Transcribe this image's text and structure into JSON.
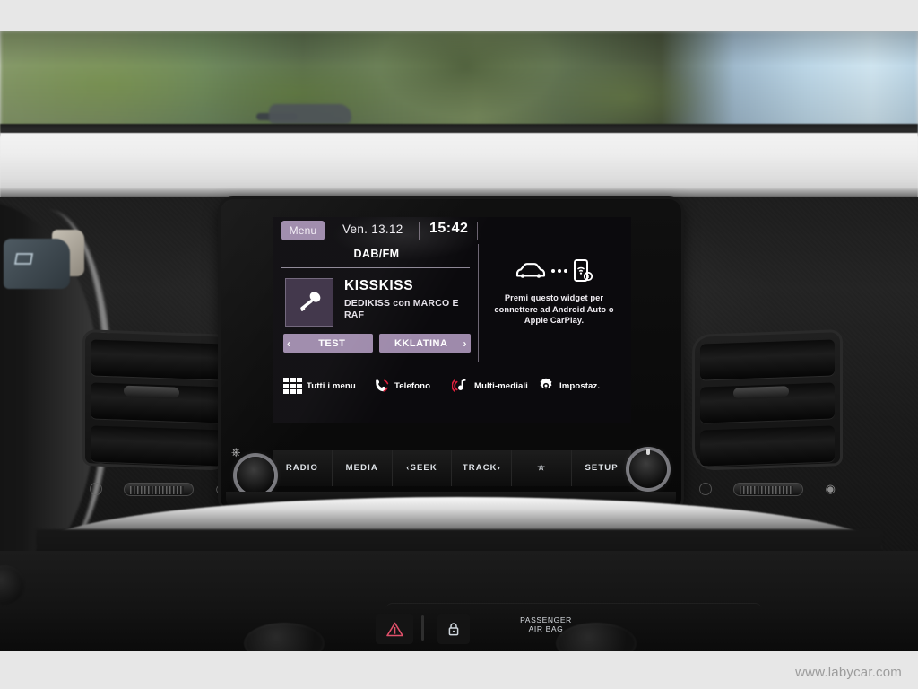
{
  "watermark": "www.labycar.com",
  "infotainment": {
    "status_bar": {
      "menu_label": "Menu",
      "date": "Ven. 13.12",
      "time": "15:42"
    },
    "source_label": "DAB/FM",
    "now_playing": {
      "station": "KISSKISS",
      "program": "DEDIKISS con MARCO E RAF",
      "art_icon": "microphone-icon"
    },
    "presets": [
      {
        "label": "TEST",
        "chevron": "‹",
        "side": "left"
      },
      {
        "label": "KKLATINA",
        "chevron": "›",
        "side": "right"
      }
    ],
    "carplay_widget": {
      "text": "Premi questo widget per connettere ad Android Auto o Apple CarPlay.",
      "icons": [
        "car-icon",
        "dots-icon",
        "smartphone-icon"
      ]
    },
    "shortcuts": [
      {
        "label": "Tutti i menu",
        "icon": "grid-icon"
      },
      {
        "label": "Telefono",
        "icon": "phone-icon"
      },
      {
        "label": "Multi-mediali",
        "icon": "music-note-icon"
      },
      {
        "label": "Impostaz.",
        "icon": "gear-icon"
      }
    ],
    "colors": {
      "accent_purple": "#9e8aab",
      "screen_bg": "#0b0a0d",
      "text_white": "#ffffff",
      "phone_red": "#e0203c"
    }
  },
  "hardware": {
    "buttons": [
      "RADIO",
      "MEDIA",
      "‹SEEK",
      "TRACK›",
      "☆",
      "SETUP"
    ],
    "left_knob": "power-volume-knob",
    "right_knob": "tune-knob",
    "power_icon": "power-icon"
  },
  "dashboard": {
    "airbag_label": "PASSENGER\nAIR BAG",
    "airbag_line1": "PASSENGER",
    "airbag_line2": "AIR BAG",
    "hazard_icon": "hazard-triangle-icon",
    "lock_icon": "door-lock-icon"
  }
}
